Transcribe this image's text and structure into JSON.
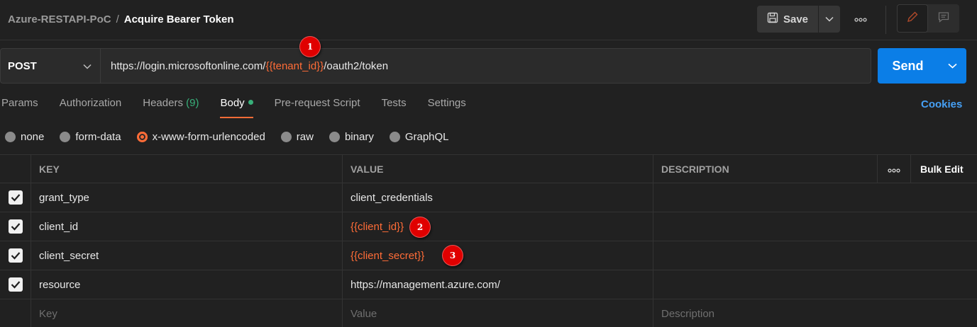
{
  "header": {
    "collection": "Azure-RESTAPI-PoC",
    "separator": "/",
    "request_name": "Acquire Bearer Token",
    "save_label": "Save"
  },
  "request": {
    "method": "POST",
    "url_prefix": "https://login.microsoftonline.com/",
    "url_var": "{{tenant_id}}",
    "url_suffix": "/oauth2/token",
    "send_label": "Send"
  },
  "tabs": [
    {
      "label": "Params"
    },
    {
      "label": "Authorization"
    },
    {
      "label": "Headers",
      "count": "(9)"
    },
    {
      "label": "Body",
      "active": true
    },
    {
      "label": "Pre-request Script"
    },
    {
      "label": "Tests"
    },
    {
      "label": "Settings"
    }
  ],
  "cookies_label": "Cookies",
  "body_types": [
    {
      "label": "none"
    },
    {
      "label": "form-data"
    },
    {
      "label": "x-www-form-urlencoded",
      "selected": true
    },
    {
      "label": "raw"
    },
    {
      "label": "binary"
    },
    {
      "label": "GraphQL"
    }
  ],
  "table": {
    "headers": {
      "key": "KEY",
      "value": "VALUE",
      "description": "DESCRIPTION",
      "bulk_edit": "Bulk Edit"
    },
    "rows": [
      {
        "key": "grant_type",
        "value": "client_credentials",
        "is_var": false
      },
      {
        "key": "client_id",
        "value": "{{client_id}}",
        "is_var": true
      },
      {
        "key": "client_secret",
        "value": "{{client_secret}}",
        "is_var": true
      },
      {
        "key": "resource",
        "value": "https://management.azure.com/",
        "is_var": false
      }
    ],
    "placeholders": {
      "key": "Key",
      "value": "Value",
      "description": "Description"
    }
  },
  "annotations": {
    "one": "1",
    "two": "2",
    "three": "3"
  },
  "colors": {
    "accent": "#ff6c37",
    "send": "#0b7ee7",
    "link": "#46a0f5",
    "badge": "#e00000"
  }
}
